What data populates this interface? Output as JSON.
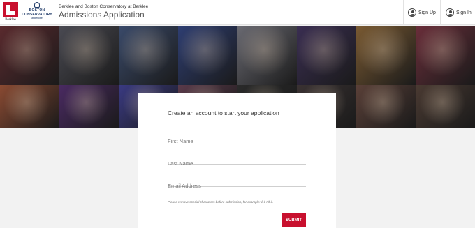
{
  "header": {
    "berklee_wordmark": "Berklee",
    "conservatory_logo": {
      "line1": "BOSTON",
      "line2": "CONSERVATORY",
      "line3": "at Berklee"
    },
    "subtitle": "Berklee and Boston Conservatory at Berklee",
    "title": "Admissions Application",
    "nav": {
      "sign_up": "Sign Up",
      "sign_in": "Sign In"
    },
    "colors": {
      "brand_red": "#c8102e",
      "conservatory_navy": "#1f3a68"
    }
  },
  "banner": {
    "tiles": [
      {
        "subject": "trumpet player",
        "color": "#5a2a2e"
      },
      {
        "subject": "headphones listener",
        "color": "#4a4a52"
      },
      {
        "subject": "dancer",
        "color": "#3a4a6a"
      },
      {
        "subject": "concert hall",
        "color": "#2e3e72"
      },
      {
        "subject": "laptop screen",
        "color": "#6a6a72"
      },
      {
        "subject": "double bass player",
        "color": "#3a2e52"
      },
      {
        "subject": "saxophone",
        "color": "#7a5a32"
      },
      {
        "subject": "saxophonist",
        "color": "#6a2e3a"
      },
      {
        "subject": "singer",
        "color": "#8a4a32"
      },
      {
        "subject": "vocal group",
        "color": "#4a2a62"
      },
      {
        "subject": "stage lights",
        "color": "#3a3a82"
      },
      {
        "subject": "stage",
        "color": "#5a3a4a"
      },
      {
        "subject": "",
        "color": "#2a2a2a"
      },
      {
        "subject": "",
        "color": "#3a3232"
      },
      {
        "subject": "ensemble",
        "color": "#5a4038"
      },
      {
        "subject": "flutists",
        "color": "#4a3a32"
      }
    ]
  },
  "form": {
    "heading": "Create an account to start your application",
    "first_name_placeholder": "First Name",
    "last_name_placeholder": "Last Name",
    "email_placeholder": "Email Address",
    "note": "Please remove special characters before submission, for example: é ô ï ñ å.",
    "submit_label": "SUBMIT"
  }
}
